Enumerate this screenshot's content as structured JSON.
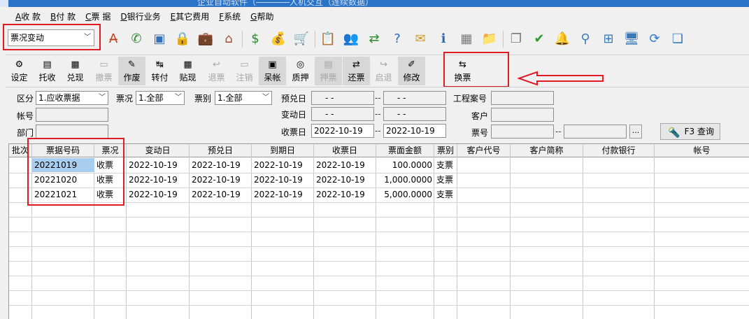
{
  "titlebar": {
    "partial_text": "企业自动软件（――――人机交互（连续数据）"
  },
  "menu": [
    {
      "acc": "A",
      "rest": "收 款"
    },
    {
      "acc": "B",
      "rest": "付 款"
    },
    {
      "acc": "C",
      "rest": "票 据"
    },
    {
      "acc": "D",
      "rest": "银行业务"
    },
    {
      "acc": "E",
      "rest": "其它费用"
    },
    {
      "acc": "F",
      "rest": "系统"
    },
    {
      "acc": "G",
      "rest": "帮助"
    }
  ],
  "toolbar": {
    "mode_value": "票况变动",
    "icons": [
      "spell-check",
      "phone",
      "computer",
      "lock",
      "briefcase",
      "home",
      "dollar-coin",
      "money-bag",
      "shopping-cart",
      "clipboard",
      "users",
      "transfer",
      "help-doc",
      "email",
      "info",
      "calculator",
      "folder",
      "copy",
      "check-circle",
      "bell",
      "magnifier",
      "org-chart",
      "monitor",
      "refresh",
      "windows"
    ]
  },
  "actions": [
    {
      "label": "设定",
      "icon": "⚙",
      "state": "normal"
    },
    {
      "label": "托收",
      "icon": "▤",
      "state": "normal"
    },
    {
      "label": "兑现",
      "icon": "▦",
      "state": "normal"
    },
    {
      "label": "撤票",
      "icon": "▭",
      "state": "disabled"
    },
    {
      "label": "作废",
      "icon": "✎",
      "state": "gray"
    },
    {
      "label": "转付",
      "icon": "↹",
      "state": "normal"
    },
    {
      "label": "贴现",
      "icon": "▦",
      "state": "normal"
    },
    {
      "label": "退票",
      "icon": "↩",
      "state": "disabled"
    },
    {
      "label": "注销",
      "icon": "▭",
      "state": "disabled"
    },
    {
      "label": "呆帐",
      "icon": "▣",
      "state": "gray"
    },
    {
      "label": "质押",
      "icon": "◎",
      "state": "normal"
    },
    {
      "label": "押票",
      "icon": "▤",
      "state": "disabled-gray"
    },
    {
      "label": "还票",
      "icon": "⇄",
      "state": "gray"
    },
    {
      "label": "启退",
      "icon": "↪",
      "state": "disabled"
    },
    {
      "label": "修改",
      "icon": "✐",
      "state": "gray"
    },
    {
      "label": "换票",
      "icon": "⇆",
      "state": "normal"
    }
  ],
  "filters": {
    "category_label": "区分",
    "category_value": "1.应收票据",
    "status_label": "票况",
    "status_value": "1.全部",
    "type_label": "票别",
    "type_value": "1.全部",
    "expected_label": "预兑日",
    "expected_from": "-  -",
    "expected_to": "-  -",
    "project_label": "工程案号",
    "account_label": "帐号",
    "change_label": "变动日",
    "change_from": "-  -",
    "change_to": "-  -",
    "customer_label": "客户",
    "dept_label": "部门",
    "receive_label": "收票日",
    "receive_from": "2022-10-19",
    "receive_to": "2022-10-19",
    "ticket_label": "票号",
    "range_dash": "--",
    "dots_label": "...",
    "query_label": "F3 查询"
  },
  "grid": {
    "columns": [
      "批次",
      "票据号码",
      "票况",
      "变动日",
      "预兑日",
      "到期日",
      "收票日",
      "票面金额",
      "票别",
      "客户代号",
      "客户简称",
      "付款银行",
      "帐号"
    ],
    "rows": [
      [
        "",
        "20221019",
        "收票",
        "2022-10-19",
        "2022-10-19",
        "2022-10-19",
        "2022-10-19",
        "100.0000",
        "支票",
        "",
        "",
        "",
        ""
      ],
      [
        "",
        "20221020",
        "收票",
        "2022-10-19",
        "2022-10-19",
        "2022-10-19",
        "2022-10-19",
        "1,000.0000",
        "支票",
        "",
        "",
        "",
        ""
      ],
      [
        "",
        "20221021",
        "收票",
        "2022-10-19",
        "2022-10-19",
        "2022-10-19",
        "2022-10-19",
        "5,000.0000",
        "支票",
        "",
        "",
        "",
        ""
      ]
    ]
  },
  "colors": {
    "highlight": "#e01b24",
    "selected_cell": "#a8cdef"
  }
}
